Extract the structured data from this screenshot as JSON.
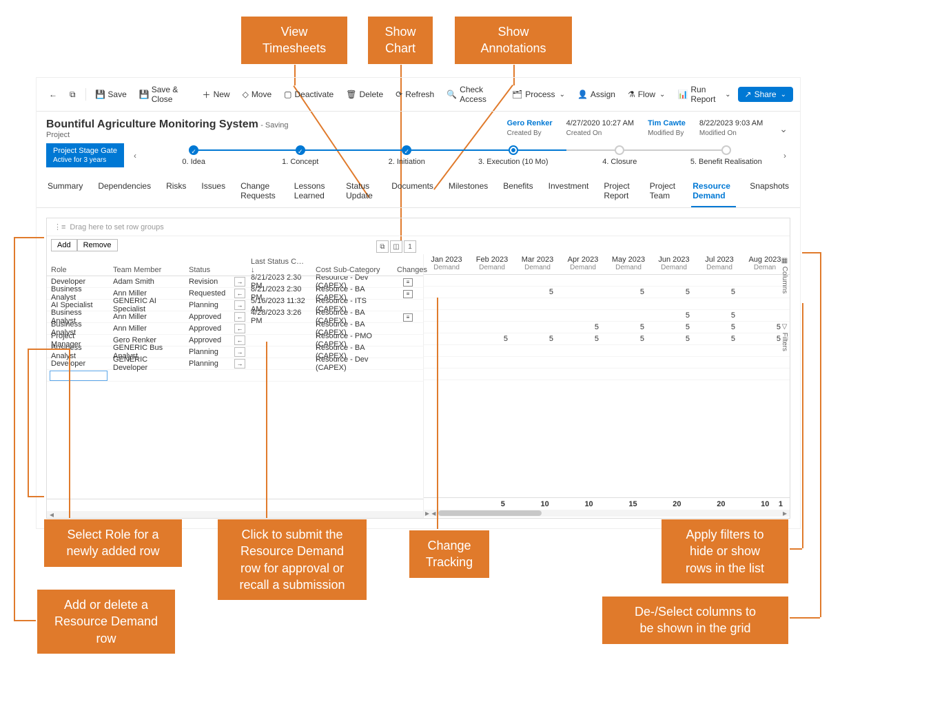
{
  "toolbar": {
    "save": "Save",
    "save_close": "Save & Close",
    "new": "New",
    "move": "Move",
    "deactivate": "Deactivate",
    "delete": "Delete",
    "refresh": "Refresh",
    "check_access": "Check Access",
    "process": "Process",
    "assign": "Assign",
    "flow": "Flow",
    "run_report": "Run Report",
    "share": "Share"
  },
  "header": {
    "title": "Bountiful Agriculture Monitoring System",
    "saving": "- Saving",
    "subtitle": "Project",
    "created_by_val": "Gero Renker",
    "created_by_lbl": "Created By",
    "created_on_val": "4/27/2020 10:27 AM",
    "created_on_lbl": "Created On",
    "modified_by_val": "Tim Cawte",
    "modified_by_lbl": "Modified By",
    "modified_on_val": "8/22/2023 9:03 AM",
    "modified_on_lbl": "Modified On"
  },
  "stage": {
    "badge_title": "Project Stage Gate",
    "badge_sub": "Active for 3 years",
    "items": [
      {
        "label": "0. Idea",
        "state": "done"
      },
      {
        "label": "1. Concept",
        "state": "done"
      },
      {
        "label": "2. Initiation",
        "state": "done"
      },
      {
        "label": "3. Execution (10 Mo)",
        "state": "current"
      },
      {
        "label": "4. Closure",
        "state": "future"
      },
      {
        "label": "5. Benefit Realisation",
        "state": "future"
      }
    ]
  },
  "tabs": [
    "Summary",
    "Dependencies",
    "Risks",
    "Issues",
    "Change Requests",
    "Lessons Learned",
    "Status Update",
    "Documents",
    "Milestones",
    "Benefits",
    "Investment",
    "Project Report",
    "Project Team",
    "Resource Demand",
    "Snapshots"
  ],
  "active_tab": "Resource Demand",
  "grid": {
    "row_groups_hint": "Drag here to set row groups",
    "add": "Add",
    "remove": "Remove",
    "year": "2023",
    "cols": {
      "role": "Role",
      "tm": "Team Member",
      "status": "Status",
      "date": "Last Status C…",
      "cost": "Cost Sub-Category",
      "chg": "Changes"
    },
    "months": [
      "Jan 2023",
      "Feb 2023",
      "Mar 2023",
      "Apr 2023",
      "May 2023",
      "Jun 2023",
      "Jul 2023",
      "Aug 2023"
    ],
    "month_sub": "Demand",
    "last_month_sub": "Deman",
    "rows": [
      {
        "role": "Developer",
        "tm": "Adam Smith",
        "status": "Revision",
        "act": "→",
        "date": "8/21/2023 2:30 PM",
        "cost": "Resource - Dev (CAPEX)",
        "chg": true,
        "vals": [
          "",
          "",
          "",
          "",
          "",
          "",
          "",
          ""
        ]
      },
      {
        "role": "Business Analyst",
        "tm": "Ann Miller",
        "status": "Requested",
        "act": "←",
        "date": "8/21/2023 2:30 PM",
        "cost": "Resource - BA (CAPEX)",
        "chg": true,
        "vals": [
          "",
          "",
          "5",
          "",
          "5",
          "5",
          "5",
          ""
        ]
      },
      {
        "role": "AI Specialist",
        "tm": "GENERIC AI Specialist",
        "status": "Planning",
        "act": "→",
        "date": "5/16/2023 11:32 AM",
        "cost": "Resource - ITS (CAPEX)",
        "chg": false,
        "vals": [
          "",
          "",
          "",
          "",
          "",
          "",
          "",
          ""
        ]
      },
      {
        "role": "Business Analyst",
        "tm": "Ann Miller",
        "status": "Approved",
        "act": "←",
        "date": "4/28/2023 3:26 PM",
        "cost": "Resource - BA (CAPEX)",
        "chg": true,
        "vals": [
          "",
          "",
          "",
          "",
          "",
          "5",
          "5",
          ""
        ]
      },
      {
        "role": "Business Analyst",
        "tm": "Ann Miller",
        "status": "Approved",
        "act": "←",
        "date": "",
        "cost": "Resource - BA (CAPEX)",
        "chg": false,
        "vals": [
          "",
          "",
          "",
          "5",
          "5",
          "5",
          "5",
          "5"
        ]
      },
      {
        "role": "Project Manager",
        "tm": "Gero Renker",
        "status": "Approved",
        "act": "←",
        "date": "",
        "cost": "Resource - PMO (CAPEX)",
        "chg": false,
        "vals": [
          "",
          "5",
          "5",
          "5",
          "5",
          "5",
          "5",
          "5"
        ]
      },
      {
        "role": "Business Analyst",
        "tm": "GENERIC Bus Analyst",
        "status": "Planning",
        "act": "→",
        "date": "",
        "cost": "Resource - BA (CAPEX)",
        "chg": false,
        "vals": [
          "",
          "",
          "",
          "",
          "",
          "",
          "",
          ""
        ]
      },
      {
        "role": "Developer",
        "tm": "GENERIC Developer",
        "status": "Planning",
        "act": "→",
        "date": "",
        "cost": "Resource - Dev (CAPEX)",
        "chg": false,
        "vals": [
          "",
          "",
          "",
          "",
          "",
          "",
          "",
          ""
        ]
      }
    ],
    "totals": [
      "",
      "5",
      "10",
      "10",
      "15",
      "20",
      "20",
      "10",
      "1"
    ]
  },
  "side": {
    "columns": "Columns",
    "filters": "Filters"
  },
  "mini": {
    "timesheet": "⧉",
    "chart": "◫",
    "anno": "1"
  },
  "callouts": {
    "view_ts": "View\nTimesheets",
    "show_chart": "Show\nChart",
    "show_anno": "Show\nAnnotations",
    "select_role": "Select Role for a\nnewly added row",
    "submit": "Click to submit the\nResource Demand\nrow for approval or\nrecall a submission",
    "change_trk": "Change\nTracking",
    "filters": "Apply filters to\nhide or show\nrows in the list",
    "add_del": "Add or delete a\nResource Demand\nrow",
    "columns": "De-/Select columns to\nbe shown in the grid"
  }
}
